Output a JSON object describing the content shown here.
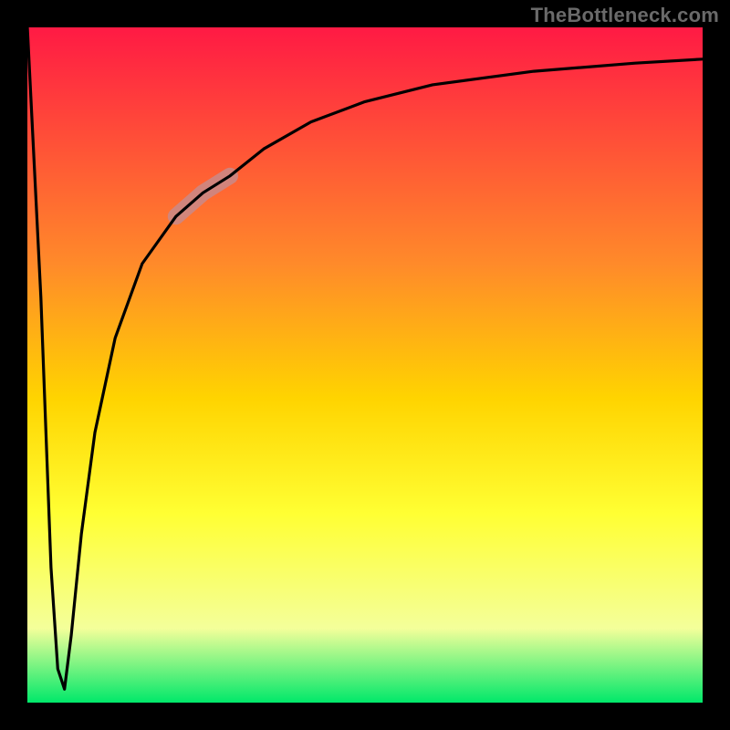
{
  "watermark": {
    "text": "TheBottleneck.com"
  },
  "colors": {
    "gradient_top": "#ff1a44",
    "gradient_mid1": "#ff8a2a",
    "gradient_mid2": "#ffd400",
    "gradient_mid3": "#ffff33",
    "gradient_mid4": "#f4ff9a",
    "gradient_bottom": "#00e86a",
    "border": "#000000",
    "curve": "#000000",
    "highlight": "#c98a8a"
  },
  "layout": {
    "outer_size": 800,
    "border_thickness": 30,
    "inner_x": 30,
    "inner_y": 30,
    "inner_w": 740,
    "inner_h": 740
  },
  "chart_data": {
    "type": "line",
    "title": "",
    "xlabel": "",
    "ylabel": "",
    "xlim": [
      0,
      100
    ],
    "ylim": [
      0,
      100
    ],
    "grid": false,
    "legend": false,
    "series": [
      {
        "name": "curve",
        "x": [
          0,
          2.0,
          3.5,
          4.5,
          5.5,
          6.5,
          8.0,
          10.0,
          13.0,
          17.0,
          22.0,
          26.0,
          30.0,
          35.0,
          42.0,
          50.0,
          60.0,
          75.0,
          90.0,
          100.0
        ],
        "y": [
          100,
          60,
          20,
          5,
          2,
          10,
          25,
          40,
          54,
          65,
          72,
          75.5,
          78,
          82,
          86,
          89,
          91.5,
          93.5,
          94.7,
          95.3
        ]
      }
    ],
    "highlight_segment": {
      "series": "curve",
      "x_range": [
        22.0,
        30.0
      ],
      "note": "thick muted-red segment on the rising part of the curve"
    },
    "gradient_background": {
      "direction": "top-to-bottom",
      "stops": [
        {
          "pos": 0.0,
          "label": "red"
        },
        {
          "pos": 0.35,
          "label": "orange"
        },
        {
          "pos": 0.55,
          "label": "gold"
        },
        {
          "pos": 0.72,
          "label": "yellow"
        },
        {
          "pos": 0.89,
          "label": "pale-yellow"
        },
        {
          "pos": 1.0,
          "label": "green"
        }
      ]
    }
  }
}
